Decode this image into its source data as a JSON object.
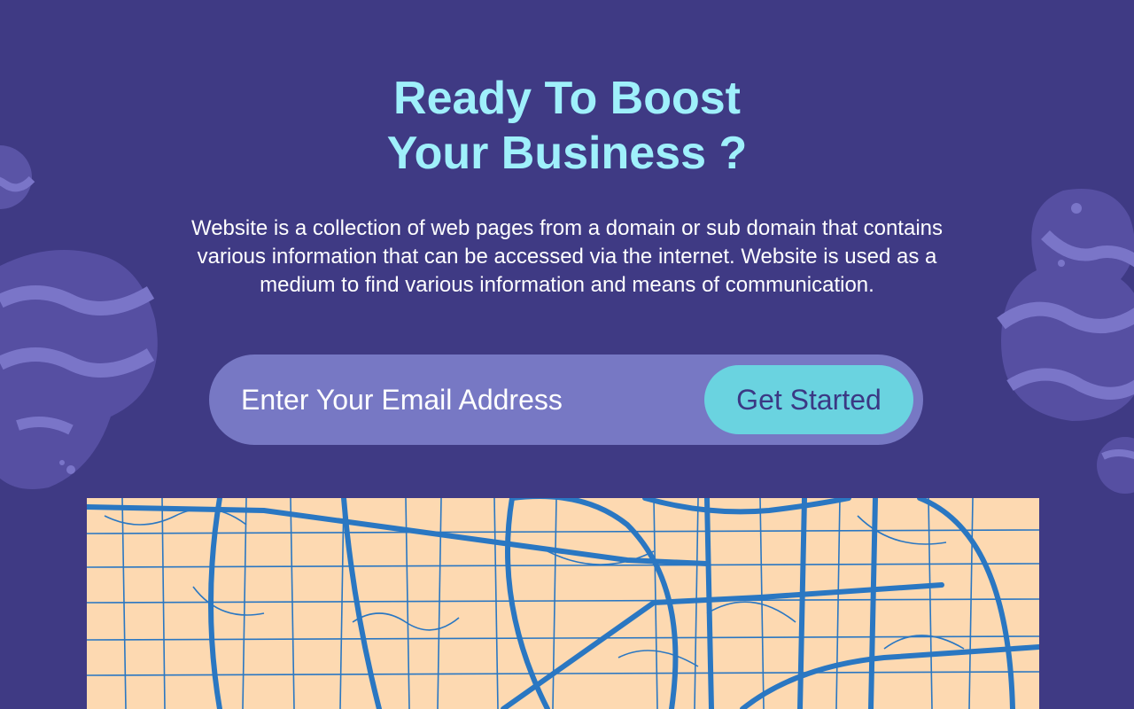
{
  "hero": {
    "title_line1": "Ready To Boost",
    "title_line2": "Your Business ?",
    "description": "Website is a collection of web pages from a domain or sub domain that contains various information that can be accessed via the internet. Website is used as a medium to find various information and means of communication."
  },
  "signup": {
    "email_placeholder": "Enter Your Email Address",
    "email_value": "",
    "cta_label": "Get Started"
  },
  "colors": {
    "background": "#3f3a84",
    "title": "#9ff0fb",
    "input_pill": "#7778c4",
    "cta": "#6ad3e0",
    "map_land": "#fdd9b1",
    "map_roads": "#2a77c2"
  },
  "decor": {
    "left_blob": "wavy-planet-blob",
    "right_blob": "wavy-planet-blob",
    "map": "street-map-illustration"
  }
}
